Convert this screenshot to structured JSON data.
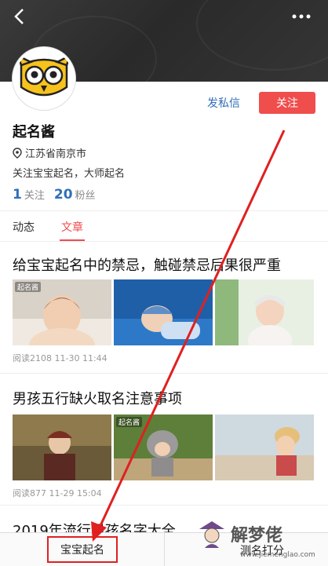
{
  "profile": {
    "name": "起名酱",
    "location": "江苏省南京市",
    "bio": "关注宝宝起名，大师起名",
    "following_count": "1",
    "following_label": "关注",
    "fans_count": "20",
    "fans_label": "粉丝"
  },
  "actions": {
    "message": "发私信",
    "follow": "关注"
  },
  "tabs": [
    "动态",
    "文章"
  ],
  "articles": [
    {
      "title": "给宝宝起名中的禁忌，触碰禁忌后果很严重",
      "meta": "阅读2108  11-30 11:44",
      "thumb_logo": "起名酱"
    },
    {
      "title": "男孩五行缺火取名注意事项",
      "meta": "阅读877  11-29 15:04",
      "thumb_logo": "起名酱"
    },
    {
      "title": "2019年流行男孩名字大全"
    }
  ],
  "bottom_bar": {
    "left": "宝宝起名",
    "right": "测名打分"
  },
  "watermark": {
    "text": "解梦佬",
    "url": "www.jiemenglao.com"
  },
  "colors": {
    "accent": "#f04d4d",
    "link": "#2f6fb8",
    "annotation": "#e02020"
  }
}
